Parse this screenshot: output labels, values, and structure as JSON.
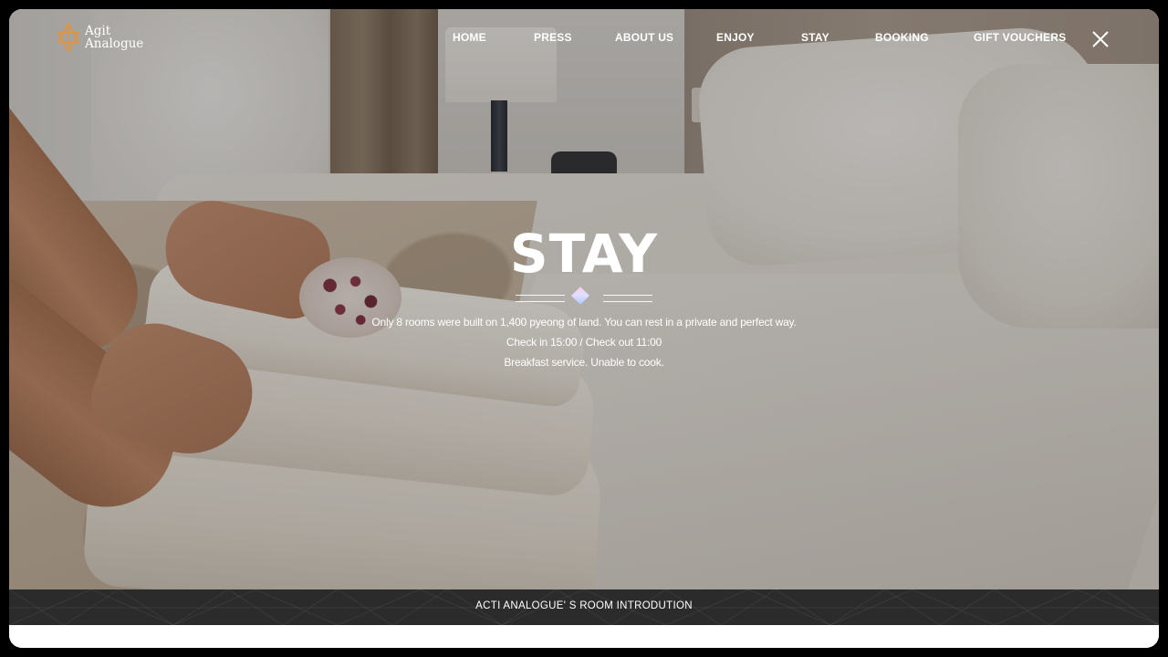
{
  "brand": {
    "line1": "Agit",
    "line2": "Analogue",
    "logo_icon": "star-of-david-logo-icon",
    "accent_color": "#d9954a"
  },
  "nav": {
    "items": [
      {
        "label": "HOME"
      },
      {
        "label": "PRESS"
      },
      {
        "label": "ABOUT US"
      },
      {
        "label": "ENJOY"
      },
      {
        "label": "STAY"
      },
      {
        "label": "BOOKING"
      },
      {
        "label": "GIFT VOUCHERS"
      }
    ],
    "close_icon": "close-icon"
  },
  "hero": {
    "title": "STAY",
    "ornament_icon": "diamond-icon",
    "lines": [
      "Only 8 rooms were built on 1,400 pyeong of land. You can rest in a private and perfect way.",
      "Check in 15:00 / Check out 11:00",
      "Breakfast service. Unable to cook."
    ]
  },
  "footer_bar": {
    "label": "ACTI ANALOGUE' S  ROOM INTRODUTION",
    "background_color": "#2b2b2b"
  }
}
